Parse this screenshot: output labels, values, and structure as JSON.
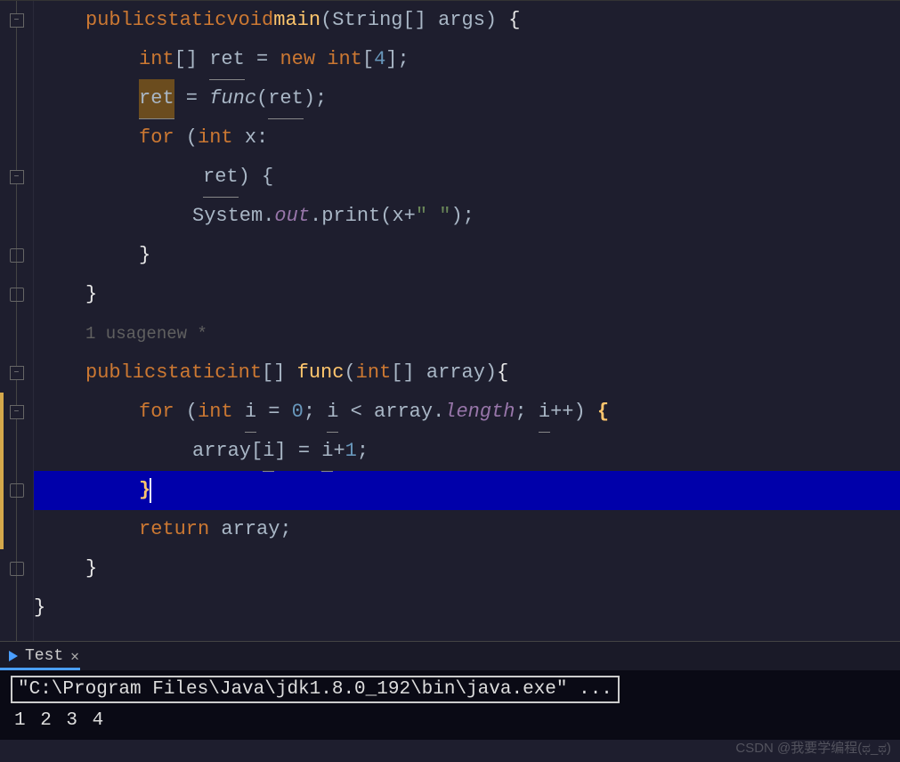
{
  "code": {
    "line1": {
      "kw1": "public",
      "kw2": "static",
      "kw3": "void",
      "fn": "main",
      "p1": "(String[] args) ",
      "br": "{"
    },
    "line2": {
      "kw": "int",
      "br": "[]",
      "sp": " ",
      "var": "ret",
      "eq": " = ",
      "kw2": "new int",
      "br2": "[",
      "num": "4",
      "br3": "];"
    },
    "line3": {
      "var": "ret",
      "eq": " = ",
      "fn": "func",
      "p1": "(",
      "arg": "ret",
      "p2": ");"
    },
    "line4": {
      "kw": "for",
      "p1": " (",
      "kw2": "int",
      "sp": " x:"
    },
    "line5": {
      "var": "ret",
      "br": ") {"
    },
    "line6": {
      "obj": "System.",
      "field": "out",
      "m": ".print(x+",
      "str": "\" \"",
      "end": ");"
    },
    "line7": {
      "br": "}"
    },
    "line8": {
      "br": "}"
    },
    "hint": {
      "usages": "1 usage",
      "author": "new *"
    },
    "line10": {
      "kw1": "public",
      "kw2": "static",
      "kw3": "int",
      "br": "[]",
      "sp": " ",
      "fn": "func",
      "p1": "(",
      "kw4": "int",
      "br2": "[] array)",
      "br3": "{"
    },
    "line11": {
      "kw": "for",
      "p1": " (",
      "kw2": "int",
      "sp": " ",
      "var": "i",
      "eq": " = ",
      "num": "0",
      "sc": "; ",
      "var2": "i",
      "lt": " < array.",
      "field": "length",
      "sc2": "; ",
      "var3": "i",
      "pp": "++) ",
      "br": "{"
    },
    "line12": {
      "arr": "array[",
      "var": "i",
      "br": "] = ",
      "var2": "i",
      "plus": "+",
      "num": "1",
      "end": ";"
    },
    "line13": {
      "br": "}"
    },
    "line14": {
      "kw": "return",
      "sp": " array;"
    },
    "line15": {
      "br": "}"
    },
    "line16": {
      "br": "}"
    }
  },
  "terminal": {
    "tab_name": "Test",
    "command": "\"C:\\Program Files\\Java\\jdk1.8.0_192\\bin\\java.exe\" ...",
    "output": "1 2 3 4"
  },
  "watermark": "CSDN @我要学编程(ಥ_ಥ)"
}
